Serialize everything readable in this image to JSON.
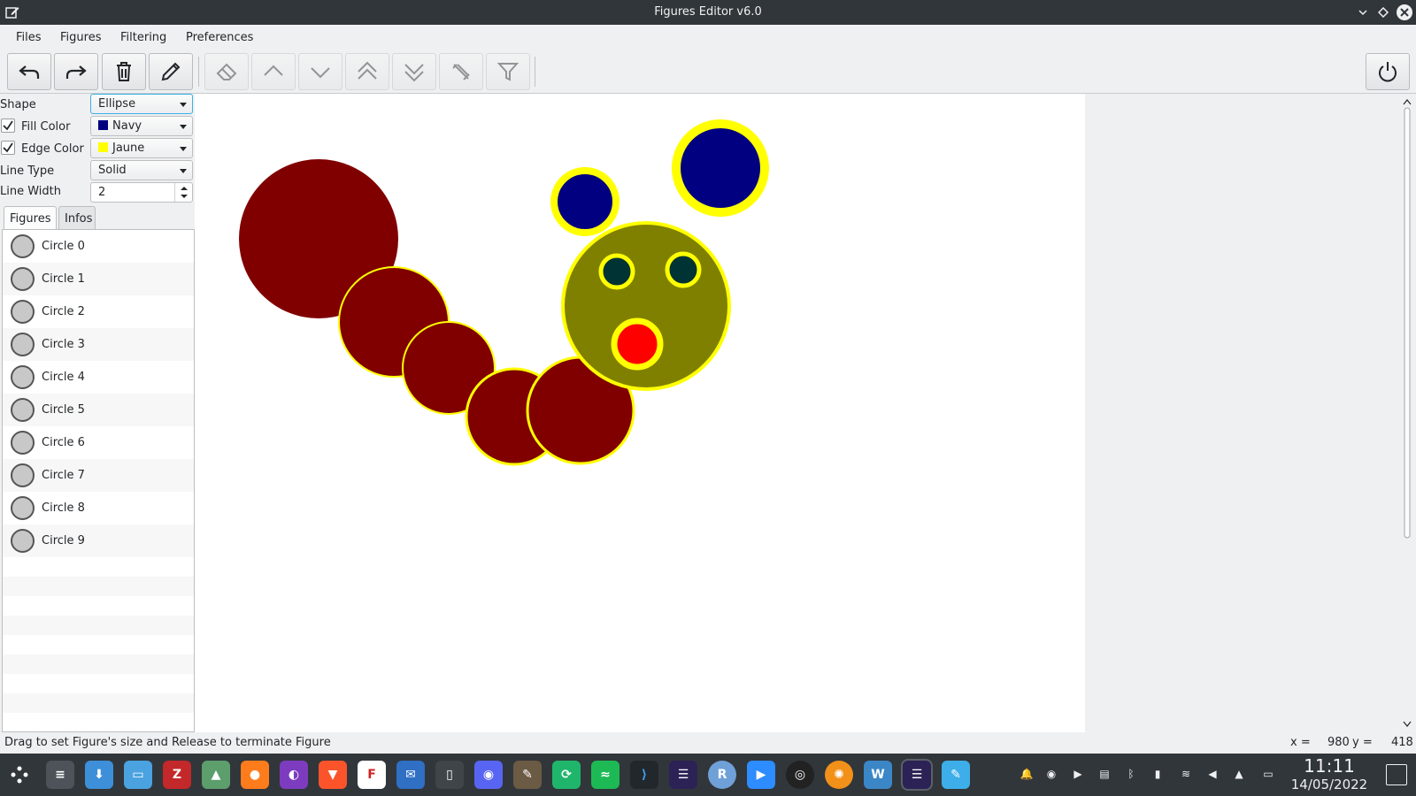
{
  "window": {
    "title": "Figures Editor v6.0"
  },
  "menu": [
    "Files",
    "Figures",
    "Filtering",
    "Preferences"
  ],
  "panel": {
    "shape_label": "Shape",
    "shape_value": "Ellipse",
    "fill_label": "Fill Color",
    "fill_value": "Navy",
    "fill_color": "#000080",
    "edge_label": "Edge Color",
    "edge_value": "Jaune",
    "edge_color": "#ffff00",
    "line_type_label": "Line Type",
    "line_type_value": "Solid",
    "line_width_label": "Line Width",
    "line_width_value": "2"
  },
  "tabs": [
    "Figures",
    "Infos"
  ],
  "figures": [
    "Circle 0",
    "Circle 1",
    "Circle 2",
    "Circle 3",
    "Circle 4",
    "Circle 5",
    "Circle 6",
    "Circle 7",
    "Circle 8",
    "Circle 9"
  ],
  "status": {
    "message": "Drag to set Figure's size and Release to terminate Figure",
    "x_label": "x =",
    "x_value": "980",
    "y_label": "y =",
    "y_value": "418"
  },
  "clock": {
    "time": "11:11",
    "date": "14/05/2022"
  },
  "colors": {
    "body": "#800000",
    "head": "#808000",
    "ears": "#000080",
    "edge": "#ffff00",
    "eyes": "#003333",
    "mouth": "#ff0000"
  }
}
